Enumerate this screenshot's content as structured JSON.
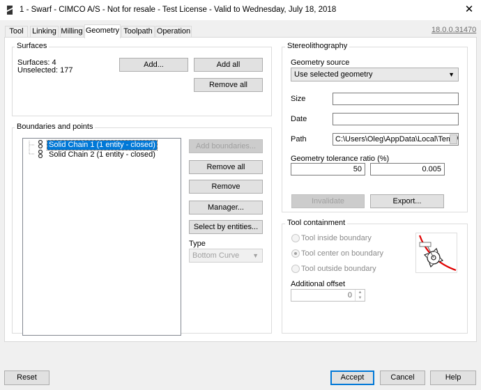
{
  "window": {
    "title": "1 - Swarf - CIMCO A/S - Not for resale - Test License - Valid to Wednesday, July 18, 2018",
    "close_glyph": "✕"
  },
  "tabs": [
    {
      "label": "Tool"
    },
    {
      "label": "Linking"
    },
    {
      "label": "Milling"
    },
    {
      "label": "Geometry",
      "active": true
    },
    {
      "label": "Toolpath"
    },
    {
      "label": "Operation"
    }
  ],
  "version": "18.0.0.31470",
  "surfaces": {
    "group_label": "Surfaces",
    "count_text": "Surfaces: 4",
    "unselected_text": "Unselected: 177",
    "add_button": "Add...",
    "add_all_button": "Add all",
    "remove_all_button": "Remove all"
  },
  "boundaries": {
    "group_label": "Boundaries and points",
    "items": [
      {
        "label": "Solid Chain 1 (1 entity - closed)",
        "selected": true
      },
      {
        "label": "Solid Chain 2 (1 entity - closed)",
        "selected": false
      }
    ],
    "add_boundaries_button": "Add boundaries...",
    "remove_all_button": "Remove all",
    "remove_button": "Remove",
    "manager_button": "Manager...",
    "select_by_entities_button": "Select by entities...",
    "type_label": "Type",
    "type_value": "Bottom Curve"
  },
  "stereolithography": {
    "group_label": "Stereolithography",
    "geometry_source_label": "Geometry source",
    "geometry_source_value": "Use selected geometry",
    "size_label": "Size",
    "size_value": "",
    "date_label": "Date",
    "date_value": "",
    "path_label": "Path",
    "path_value": "C:\\Users\\Oleg\\AppData\\Local\\Temp\\",
    "tolerance_label": "Geometry tolerance ratio (%)",
    "tolerance_percent": "50",
    "tolerance_value": "0.005",
    "invalidate_button": "Invalidate",
    "export_button": "Export..."
  },
  "tool_containment": {
    "group_label": "Tool containment",
    "options": [
      {
        "label": "Tool inside boundary",
        "selected": false
      },
      {
        "label": "Tool center on boundary",
        "selected": true
      },
      {
        "label": "Tool outside boundary",
        "selected": false
      }
    ],
    "offset_label": "Additional offset",
    "offset_value": "0",
    "accent_color": "#e00000"
  },
  "footer": {
    "reset_button": "Reset",
    "accept_button": "Accept",
    "cancel_button": "Cancel",
    "help_button": "Help"
  }
}
